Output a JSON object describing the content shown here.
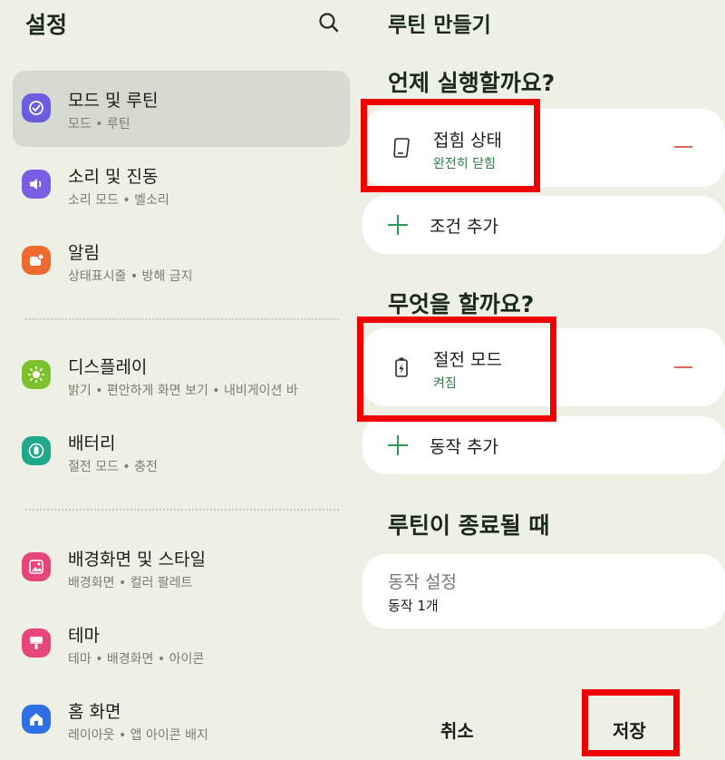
{
  "settings": {
    "title": "설정",
    "search_icon": "search-icon",
    "items": [
      {
        "title": "모드 및 루틴",
        "subtitle": "모드 • 루틴",
        "icon": "modes-routines-icon",
        "color": "#6c5ce0",
        "active": true
      },
      {
        "title": "소리 및 진동",
        "subtitle": "소리 모드 • 벨소리",
        "icon": "speaker-icon",
        "color": "#7b5de6"
      },
      {
        "title": "알림",
        "subtitle": "상태표시줄 • 방해 금지",
        "icon": "notification-icon",
        "color": "#ee6a2f"
      },
      {
        "title": "디스플레이",
        "subtitle": "밝기 • 편안하게 화면 보기 • 내비게이션 바",
        "icon": "sun-icon",
        "color": "#7cc22c"
      },
      {
        "title": "배터리",
        "subtitle": "절전 모드 • 충전",
        "icon": "battery-icon",
        "color": "#20a88a"
      },
      {
        "title": "배경화면 및 스타일",
        "subtitle": "배경화면 • 컬러 팔레트",
        "icon": "wallpaper-icon",
        "color": "#e8457a"
      },
      {
        "title": "테마",
        "subtitle": "테마 • 배경화면 • 아이콘",
        "icon": "theme-brush-icon",
        "color": "#e8457a"
      },
      {
        "title": "홈 화면",
        "subtitle": "레이아웃 • 앱 아이콘 배지",
        "icon": "home-icon",
        "color": "#2f6fe6"
      }
    ]
  },
  "routine": {
    "title": "루틴 만들기",
    "when_header": "언제 실행할까요?",
    "condition": {
      "title": "접힘 상태",
      "subtitle": "완전히 닫힘",
      "icon": "fold-phone-icon"
    },
    "add_condition": "조건 추가",
    "what_header": "무엇을 할까요?",
    "action": {
      "title": "절전 모드",
      "subtitle": "켜짐",
      "icon": "power-saving-battery-icon"
    },
    "add_action": "동작 추가",
    "end_header": "루틴이 종료될 때",
    "end_card": {
      "title": "동작 설정",
      "subtitle": "동작 1개"
    },
    "cancel_label": "취소",
    "save_label": "저장"
  },
  "colors": {
    "background": "#eef0e6",
    "accent_green": "#2e9a55",
    "minus_red": "#d96a5c",
    "highlight_red": "#f20000"
  }
}
